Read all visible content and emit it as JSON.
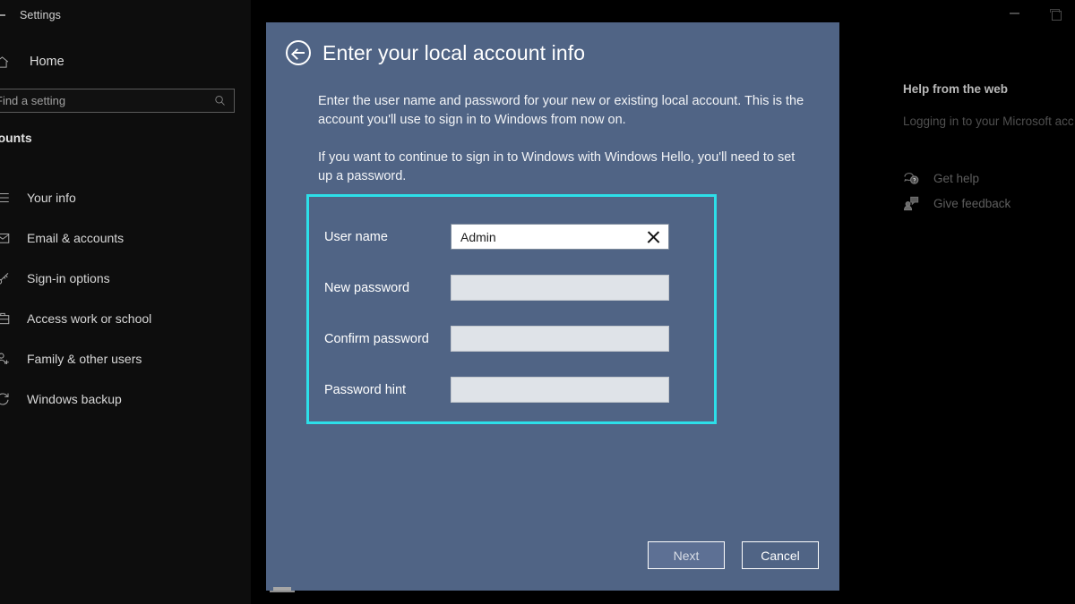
{
  "window": {
    "title": "Settings",
    "back_icon": "back-arrow-icon",
    "minimize_label": "Minimize",
    "maximize_label": "Maximize"
  },
  "sidebar": {
    "home": {
      "label": "Home",
      "icon": "home-icon"
    },
    "search": {
      "value": "",
      "placeholder": "Find a setting",
      "icon": "search-icon"
    },
    "section_header": "ccounts",
    "items": [
      {
        "label": "Your info",
        "icon": "user-info-icon"
      },
      {
        "label": "Email & accounts",
        "icon": "envelope-icon"
      },
      {
        "label": "Sign-in options",
        "icon": "key-icon"
      },
      {
        "label": "Access work or school",
        "icon": "briefcase-icon"
      },
      {
        "label": "Family & other users",
        "icon": "people-icon"
      },
      {
        "label": "Windows backup",
        "icon": "sync-icon"
      }
    ]
  },
  "help_panel": {
    "title": "Help from the web",
    "link": "Logging in to your Microsoft acc",
    "actions": [
      {
        "label": "Get help",
        "icon": "question-bubble-icon"
      },
      {
        "label": "Give feedback",
        "icon": "feedback-person-icon"
      }
    ]
  },
  "dialog": {
    "back_icon": "back-circle-icon",
    "title": "Enter your local account info",
    "paragraphs": [
      "Enter the user name and password for your new or existing local account. This is the account you'll use to sign in to Windows from now on.",
      "If you want to continue to sign in to Windows with Windows Hello, you'll need to set up a password."
    ],
    "highlight_color": "#2ddfe9",
    "background_color": "#506485",
    "fields": [
      {
        "label": "User name",
        "value": "Admin",
        "filled": true,
        "clear_icon": "clear-x-icon"
      },
      {
        "label": "New password",
        "value": "",
        "filled": false
      },
      {
        "label": "Confirm password",
        "value": "",
        "filled": false
      },
      {
        "label": "Password hint",
        "value": "",
        "filled": false
      }
    ],
    "buttons": {
      "next": "Next",
      "cancel": "Cancel"
    }
  }
}
